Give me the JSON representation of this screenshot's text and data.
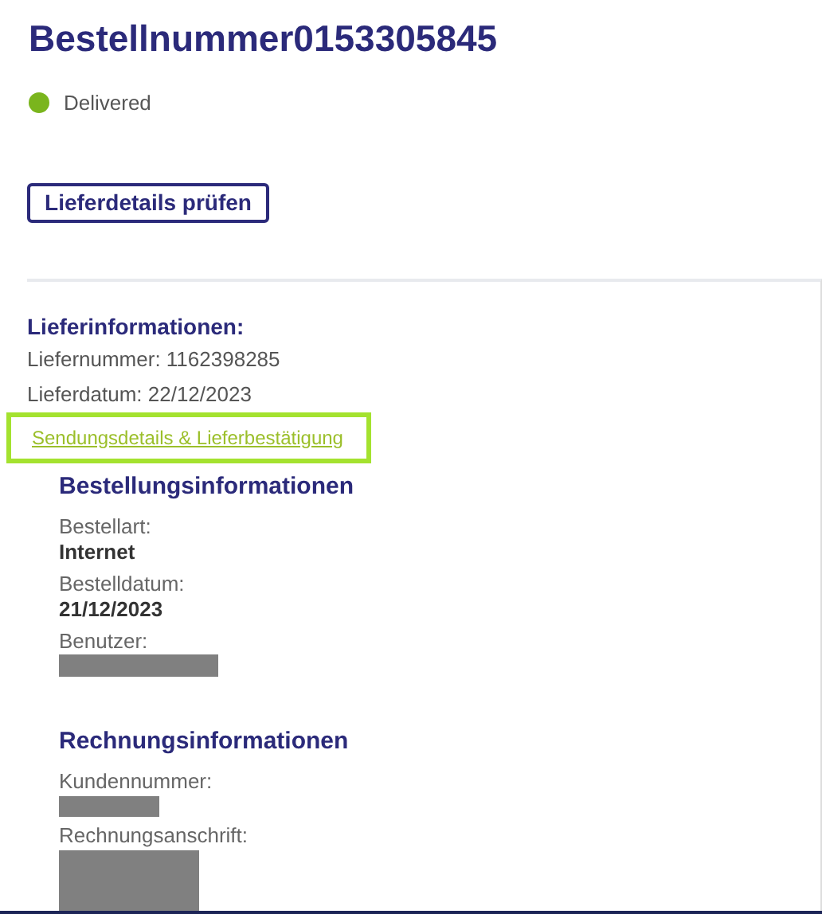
{
  "title": "Bestellnummer0153305845",
  "status": {
    "label": "Delivered",
    "color": "#7ab51d"
  },
  "button": "Lieferdetails prüfen",
  "delivery": {
    "heading": "Lieferinformationen:",
    "lines": [
      "Liefernummer: 1162398285",
      "Lieferdatum: 22/12/2023"
    ],
    "link": {
      "label": "Sendungsdetails & Lieferbestätigung",
      "highlighted": true
    }
  },
  "sections": [
    {
      "heading": "Bestellungsinformationen",
      "fields": [
        {
          "label": "Bestellart:",
          "kind": "text",
          "value": "Internet"
        },
        {
          "label": "Bestelldatum:",
          "kind": "text",
          "value": "21/12/2023"
        },
        {
          "label": "Benutzer:",
          "kind": "redacted"
        }
      ]
    },
    {
      "heading": "Rechnungsinformationen",
      "fields": [
        {
          "label": "Kundennummer:",
          "kind": "redacted"
        },
        {
          "label": "Rechnungsanschrift:",
          "kind": "redacted"
        }
      ]
    }
  ]
}
